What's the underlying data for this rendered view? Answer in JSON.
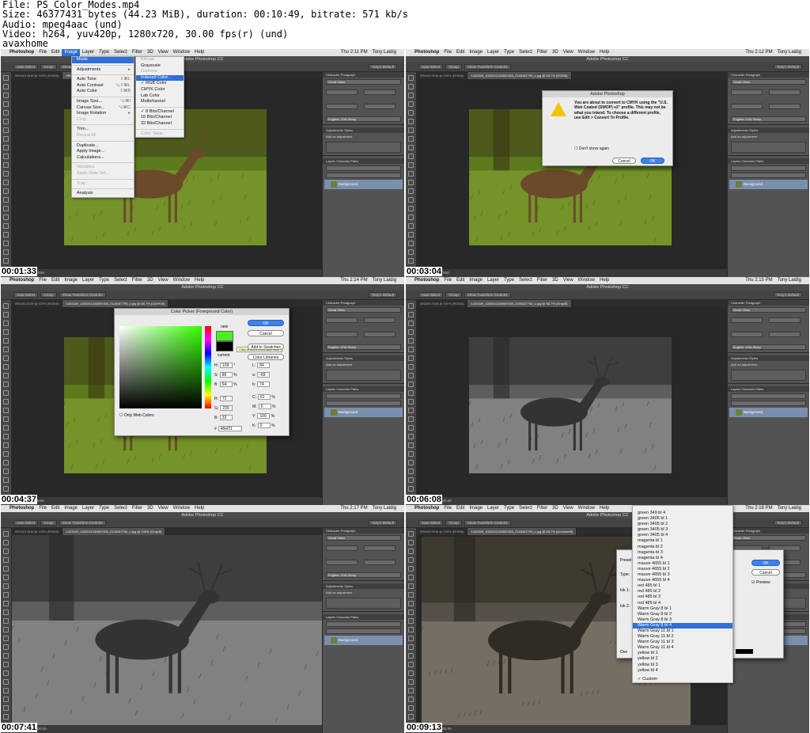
{
  "header": {
    "line1": "File: PS_Color_Modes.mp4",
    "line2": "Size: 46377431 bytes (44.23 MiB), duration: 00:10:49, bitrate: 571 kb/s",
    "line3": "Audio: mpeg4aac (und)",
    "line4": "Video: h264, yuv420p, 1280x720, 30.00 fps(r) (und)",
    "line5": "avaxhome"
  },
  "app": {
    "apple": "",
    "menu": [
      "Photoshop",
      "File",
      "Edit",
      "Image",
      "Layer",
      "Type",
      "Select",
      "Filter",
      "3D",
      "View",
      "Window",
      "Help"
    ],
    "user": "Tony Laidig",
    "title": "Adobe Photoshop CC",
    "essentials": "Tony's Default",
    "panel_tabs": [
      "Character",
      "Paragraph"
    ],
    "adjust_tab": "Adjustments",
    "styles_tab": "Styles",
    "add_adjust": "Add an adjustment",
    "layers_tabs": [
      "Layers",
      "Channels",
      "Paths"
    ],
    "layer_name": "Background",
    "font_name": "Great Vibes",
    "lang": "English: USA",
    "sharp": "Sharp",
    "tool_mode": "Group",
    "auto_select": "Auto-Select",
    "show_transform": "Show Transform Controls"
  },
  "frames": [
    {
      "time": "00:01:33",
      "clock": "Thu 2:11 PM",
      "tab": "0R0A9178.tif @ 100% (RGB/8)",
      "doc": "Doc: 1.76M/1.76M"
    },
    {
      "time": "00:03:04",
      "clock": "Thu 2:12 PM",
      "tab": "1424349_1020241243697455_2145187793_o.jpg @ 66.7% (RGB/8)",
      "doc": "Doc: 1.76M/1.76M"
    },
    {
      "time": "00:04:37",
      "clock": "Thu 2:14 PM",
      "tab": "1424349_1020241243697455_2145187793_o.jpg @ 66.7% (CMYK/8)",
      "doc": "Doc: 2.94M/2.94M"
    },
    {
      "time": "00:06:08",
      "clock": "Thu 2:15 PM",
      "tab": "1424349_1020241243697455_2145187793_o.jpg @ 66.7% (Gray/8)",
      "doc": "Doc: 600.0K/600.0K"
    },
    {
      "time": "00:07:41",
      "clock": "Thu 2:17 PM",
      "tab": "1424349_1020241243697455_2145187793_o.jpg @ 100% (Gray/8)",
      "doc": "Doc: 600.0K/600.0K"
    },
    {
      "time": "00:09:13",
      "clock": "Thu 2:18 PM",
      "tab": "1424349_1020241243697455_2145187793_o.jpg @ 66.7% (Duotone/8)",
      "doc": "Doc: 600.0K/600.0K"
    }
  ],
  "image_menu": [
    "Mode",
    "Adjustments",
    "Auto Tone",
    "Auto Contrast",
    "Auto Color",
    "Image Size...",
    "Canvas Size...",
    "Image Rotation",
    "Crop",
    "Trim...",
    "Reveal All",
    "Duplicate...",
    "Apply Image...",
    "Calculations...",
    "Variables",
    "Apply Data Set...",
    "Trap...",
    "Analysis"
  ],
  "mode_menu": [
    "Bitmap",
    "Grayscale",
    "Duotone",
    "Indexed Color...",
    "RGB Color",
    "CMYK Color",
    "Lab Color",
    "Multichannel",
    "8 Bits/Channel",
    "16 Bits/Channel",
    "32 Bits/Channel",
    "Color Table..."
  ],
  "cmyk_dialog": {
    "title": "Adobe Photoshop",
    "message": "You are about to convert to CMYK using the \"U.S. Web Coated (SWOP) v2\" profile. This may not be what you intend. To choose a different profile, use Edit > Convert To Profile.",
    "checkbox": "Don't show again",
    "cancel": "Cancel",
    "ok": "OK"
  },
  "color_picker": {
    "title": "Color Picker (Foreground Color)",
    "ok": "OK",
    "cancel": "Cancel",
    "add_swatches": "Add to Swatches",
    "libraries": "Color Libraries",
    "new": "new",
    "current": "current",
    "web_only": "Only Web Colors",
    "tooltip": "Click to select web safe color",
    "H": "109",
    "S": "86",
    "B": "94",
    "R": "72",
    "G": "239",
    "Bv": "33",
    "L": "84",
    "a": "-69",
    "b": "74",
    "C": "61",
    "M": "0",
    "Y": "100",
    "K": "0",
    "hex": "48ef21",
    "new_color": "#48ef21",
    "cur_color": "#000000"
  },
  "duotone": {
    "inks_list": [
      "green 349 bl 4",
      "green 3405 bl 1",
      "green 3405 bl 2",
      "green 3405 bl 3",
      "green 3405 bl 4",
      "magenta bl 1",
      "magenta bl 2",
      "magenta bl 3",
      "magenta bl 4",
      "mauve 4655 bl 1",
      "mauve 4655 bl 2",
      "mauve 4655 bl 3",
      "mauve 4655 bl 4",
      "red 485 bl 1",
      "red 485 bl 2",
      "red 485 bl 3",
      "red 485 bl 4",
      "Warm Gray 8 bl 1",
      "Warm Gray 8 bl 2",
      "Warm Gray 8 bl 3",
      "Warm Gray 8 bl 4",
      "Warm Gray 11 bl 1",
      "Warm Gray 11 bl 2",
      "Warm Gray 11 bl 3",
      "Warm Gray 11 bl 4",
      "yellow bl 1",
      "yellow bl 2",
      "yellow bl 3",
      "yellow bl 4",
      "Custom"
    ],
    "selected": "Warm Gray 8 bl 4",
    "ok": "OK",
    "cancel": "Cancel",
    "preview": "Preview",
    "preset": "Preset:",
    "type": "Type:",
    "ink1": "Ink 1:",
    "ink2": "Ink 2:",
    "overprint": "Ove"
  },
  "colors": {
    "accent": "#2f6fd6",
    "ps_dark": "#3b3b3b",
    "grass": "#6f8a2a"
  }
}
